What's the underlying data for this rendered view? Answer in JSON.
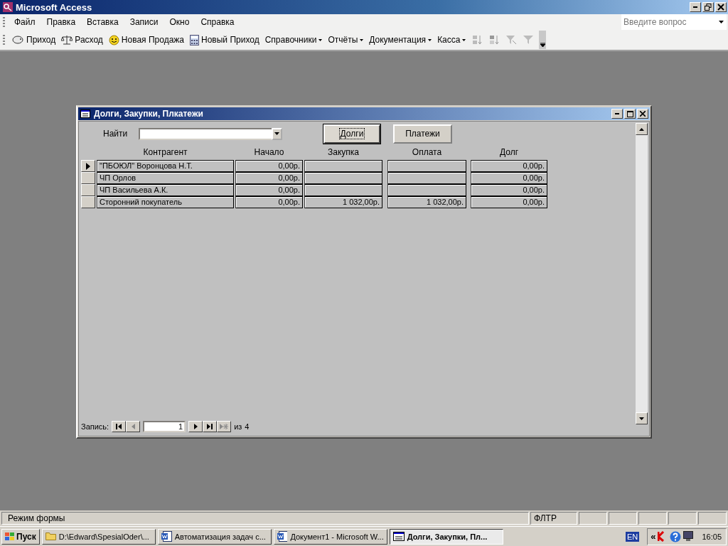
{
  "app_window": {
    "title": "Microsoft Access"
  },
  "menu": [
    "Файл",
    "Правка",
    "Вставка",
    "Записи",
    "Окно",
    "Справка"
  ],
  "help_search": {
    "placeholder": "Введите вопрос"
  },
  "toolbar": [
    {
      "kind": "button",
      "label": "Приход"
    },
    {
      "kind": "button",
      "label": "Расход"
    },
    {
      "kind": "button",
      "label": "Новая Продажа"
    },
    {
      "kind": "button",
      "label": "Новый Приход"
    },
    {
      "kind": "menu",
      "label": "Справочники"
    },
    {
      "kind": "menu",
      "label": "Отчёты"
    },
    {
      "kind": "menu",
      "label": "Документация"
    },
    {
      "kind": "menu",
      "label": "Касса"
    }
  ],
  "form": {
    "title": "Долги, Закупки, Плкатежи",
    "find": {
      "label": "Найти"
    },
    "buttons": [
      {
        "label": "Долги",
        "focused": true
      },
      {
        "label": "Платежи",
        "focused": false
      }
    ],
    "columns": [
      "Контрагент",
      "Начало",
      "Закупка",
      "Оплата",
      "Долг"
    ],
    "rows": [
      {
        "selected": true,
        "counterparty": "\"ПБОЮЛ\" Воронцова Н.Т.",
        "start": "0,00р.",
        "debt": "0,00р."
      },
      {
        "selected": false,
        "counterparty": "ЧП Орлов",
        "start": "0,00р.",
        "debt": "0,00р."
      },
      {
        "selected": false,
        "counterparty": "ЧП Васильева А.К.",
        "start": "0,00р.",
        "debt": "0,00р."
      },
      {
        "selected": false,
        "counterparty": "Сторонний покупатель",
        "start": "0,00р.",
        "purchase": "1 032,00р.",
        "payment": "1 032,00р.",
        "debt": "0,00р."
      }
    ],
    "navigation": {
      "label": "Запись:",
      "current": "1",
      "of": "из",
      "total": "4"
    }
  },
  "status_bar": {
    "mode": "Режим формы",
    "indicator": "ФЛТР"
  },
  "taskbar": {
    "start": "Пуск",
    "tasks": [
      {
        "label": "D:\\Edward\\SpesialOder\\...",
        "selected": false
      },
      {
        "label": "Автоматизация задач с...",
        "selected": false
      },
      {
        "label": "Документ1 - Microsoft W...",
        "selected": false
      },
      {
        "label": "Долги, Закупки, Пл...",
        "selected": true
      }
    ],
    "tray": {
      "expand": "«",
      "language": "EN",
      "time": "16:05"
    }
  }
}
